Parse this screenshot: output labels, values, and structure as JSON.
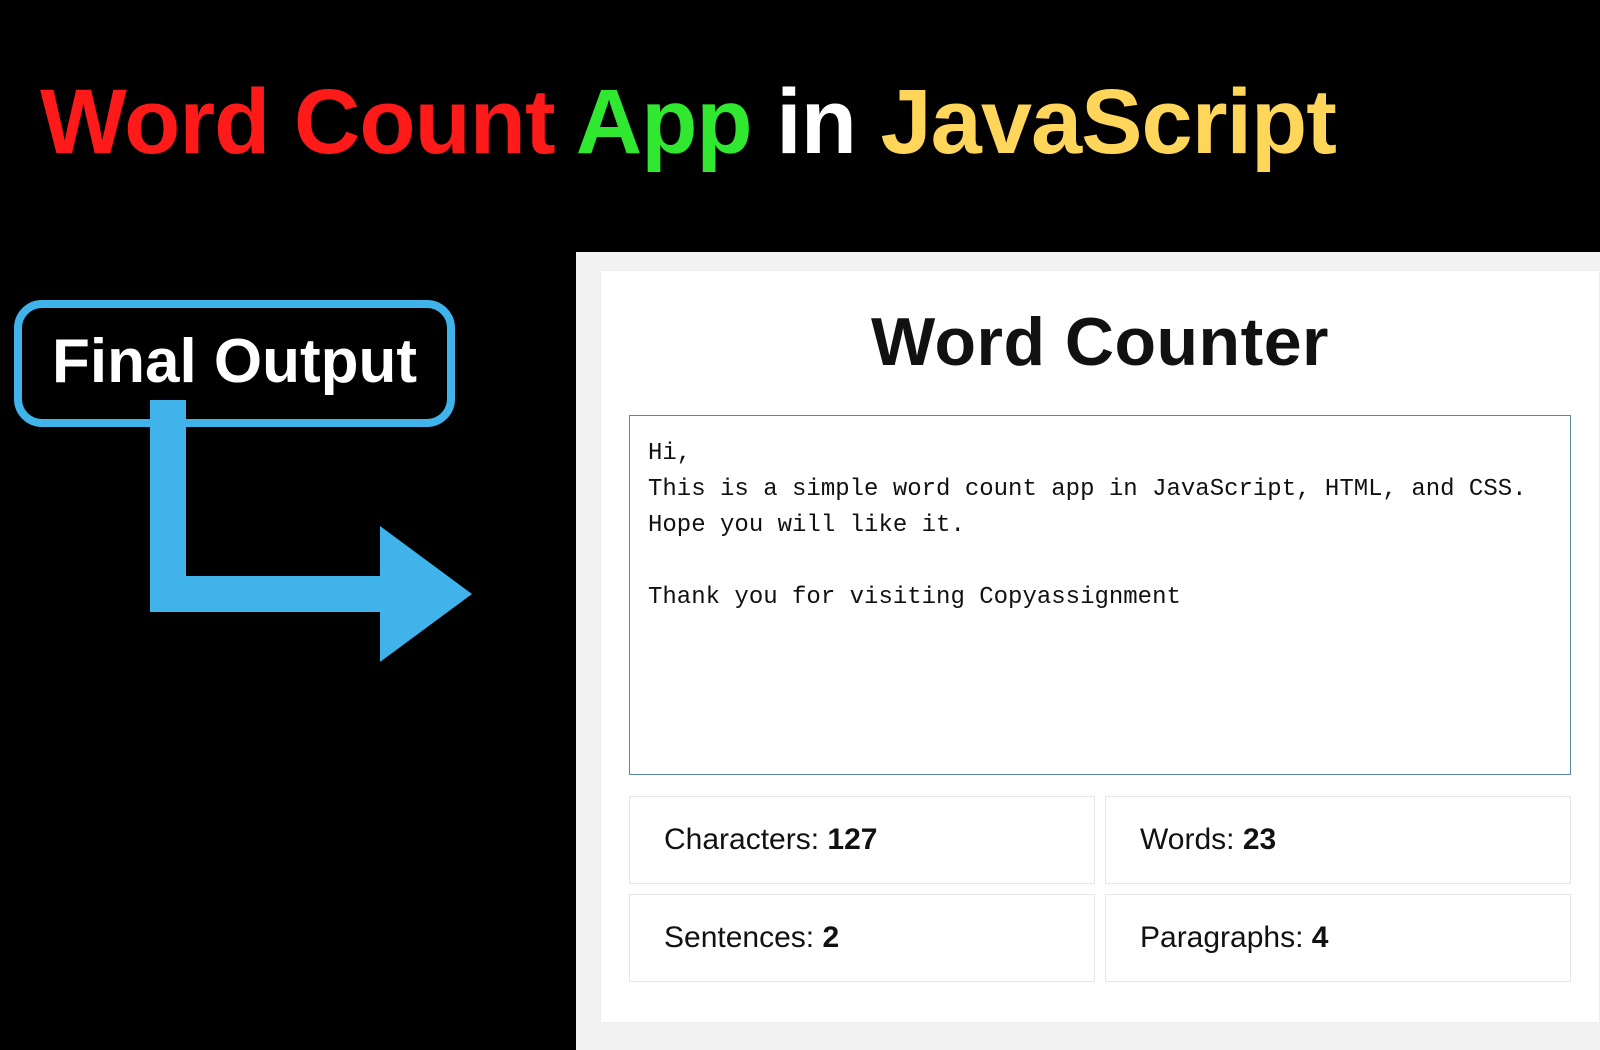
{
  "title": {
    "p1": "Word Count",
    "p2": "App",
    "p3": "in",
    "p4": "JavaScript"
  },
  "badge_label": "Final Output",
  "app": {
    "heading": "Word Counter",
    "text": "Hi,\nThis is a simple word count app in JavaScript, HTML, and CSS.\nHope you will like it.\n\nThank you for visiting Copyassignment",
    "stats": {
      "characters_label": "Characters: ",
      "characters_value": "127",
      "words_label": "Words: ",
      "words_value": "23",
      "sentences_label": "Sentences: ",
      "sentences_value": "2",
      "paragraphs_label": "Paragraphs: ",
      "paragraphs_value": "4"
    }
  }
}
